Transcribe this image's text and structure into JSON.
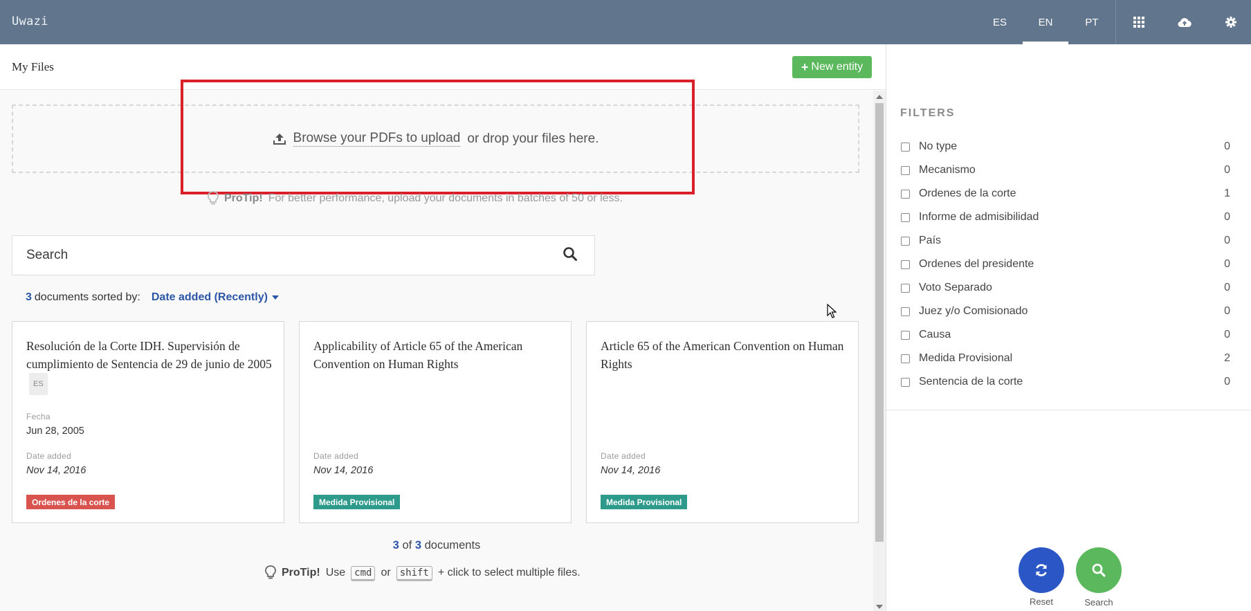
{
  "navbar": {
    "brand": "Uwazi",
    "languages": [
      {
        "code": "ES",
        "active": false
      },
      {
        "code": "EN",
        "active": true
      },
      {
        "code": "PT",
        "active": false
      }
    ],
    "icons": [
      "grid-icon",
      "cloud-upload-icon",
      "gear-icon"
    ]
  },
  "header": {
    "title": "My Files",
    "new_entity_label": "New entity"
  },
  "upload": {
    "link_text": "Browse your PDFs to upload",
    "rest_text": "or drop your files here.",
    "protip_label": "ProTip!",
    "protip_text": "For better performance, upload your documents in batches of 50 or less."
  },
  "search": {
    "placeholder": "Search"
  },
  "sort": {
    "count": "3",
    "text": "documents sorted by:",
    "value": "Date added (Recently)"
  },
  "cards": [
    {
      "title": "Resolución de la Corte IDH. Supervisión de cumplimiento de Sentencia de 29 de junio de 2005",
      "lang_badge": "ES",
      "fecha_label": "Fecha",
      "fecha_value": "Jun 28, 2005",
      "date_label": "Date added",
      "date_value": "Nov 14, 2016",
      "type": "Ordenes de la corte",
      "type_color": "#d9534f"
    },
    {
      "title": "Applicability of Article 65 of the American Convention on Human Rights",
      "date_label": "Date added",
      "date_value": "Nov 14, 2016",
      "type": "Medida Provisional",
      "type_color": "#2e9a8c"
    },
    {
      "title": "Article 65 of the American Convention on Human Rights",
      "date_label": "Date added",
      "date_value": "Nov 14, 2016",
      "type": "Medida Provisional",
      "type_color": "#2e9a8c"
    }
  ],
  "footer": {
    "shown": "3",
    "of": "of",
    "total": "3",
    "docs": "documents",
    "protip_label": "ProTip!",
    "protip_use": "Use",
    "key1": "cmd",
    "or": "or",
    "key2": "shift",
    "protip_end": "+ click to select multiple files."
  },
  "filters": {
    "title": "FILTERS",
    "items": [
      {
        "label": "No type",
        "count": "0"
      },
      {
        "label": "Mecanismo",
        "count": "0"
      },
      {
        "label": "Ordenes de la corte",
        "count": "1"
      },
      {
        "label": "Informe de admisibilidad",
        "count": "0"
      },
      {
        "label": "País",
        "count": "0"
      },
      {
        "label": "Ordenes del presidente",
        "count": "0"
      },
      {
        "label": "Voto Separado",
        "count": "0"
      },
      {
        "label": "Juez y/o Comisionado",
        "count": "0"
      },
      {
        "label": "Causa",
        "count": "0"
      },
      {
        "label": "Medida Provisional",
        "count": "2"
      },
      {
        "label": "Sentencia de la corte",
        "count": "0"
      }
    ]
  },
  "actions": {
    "reset_label": "Reset",
    "search_label": "Search",
    "reset_color": "#2b56c5",
    "search_color": "#5cb85c"
  }
}
